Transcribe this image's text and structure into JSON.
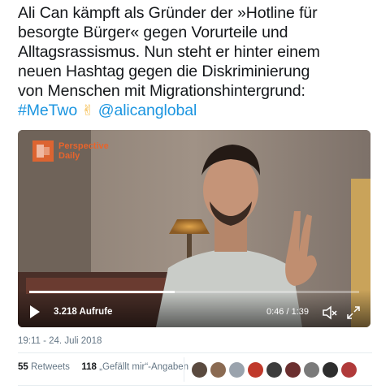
{
  "tweet": {
    "lines": [
      "Ali Can kämpft als Gründer der »Hotline für",
      "besorgte Bürger« gegen Vorurteile und",
      "Alltagsrassismus. Nun steht er hinter einem",
      "neuen Hashtag gegen die Diskriminierung",
      "von Menschen mit Migrationshintergrund:"
    ],
    "hashtag": "#MeTwo",
    "emoji": "✌",
    "mention": "@alicanglobal"
  },
  "video": {
    "logo_line1": "Perspective",
    "logo_line2": "Daily",
    "views": "3.218 Aufrufe",
    "time": "0:46 / 1:39",
    "progress_fraction": 0.44,
    "accent_color": "#e8642c"
  },
  "meta": {
    "timestamp": "19:11 - 24. Juli 2018",
    "retweets_count": "55",
    "retweets_label": "Retweets",
    "likes_count": "118",
    "likes_label": "„Gefällt mir“-Angaben"
  },
  "avatars": [
    {
      "color": "#5a4a3f"
    },
    {
      "color": "#8a6a52"
    },
    {
      "color": "#9aa3ad"
    },
    {
      "color": "#c0392b"
    },
    {
      "color": "#3c3c3c"
    },
    {
      "color": "#6b2f2f"
    },
    {
      "color": "#7a7a7a"
    },
    {
      "color": "#2e2e2e"
    },
    {
      "color": "#b03a3a"
    }
  ]
}
